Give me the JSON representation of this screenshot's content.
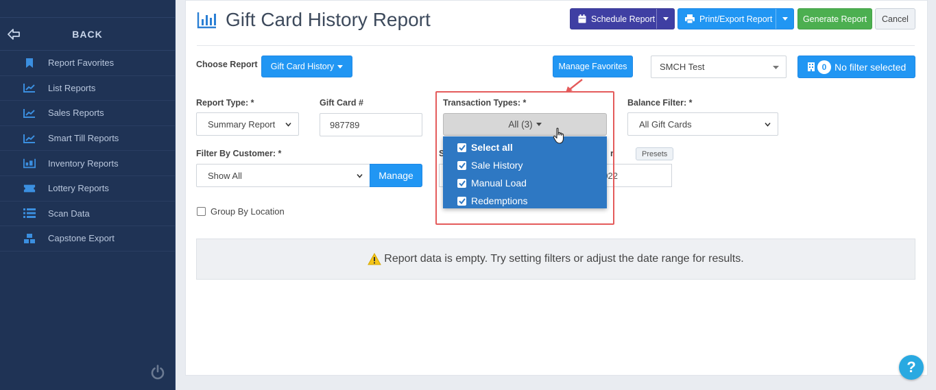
{
  "sidebar": {
    "back_label": "BACK",
    "items": [
      {
        "label": "Report Favorites",
        "icon": "bookmark-icon"
      },
      {
        "label": "List Reports",
        "icon": "line-chart-icon"
      },
      {
        "label": "Sales Reports",
        "icon": "line-chart-icon"
      },
      {
        "label": "Smart Till Reports",
        "icon": "line-chart-icon"
      },
      {
        "label": "Inventory Reports",
        "icon": "inventory-icon"
      },
      {
        "label": "Lottery Reports",
        "icon": "ticket-icon"
      },
      {
        "label": "Scan Data",
        "icon": "list-icon"
      },
      {
        "label": "Capstone Export",
        "icon": "boxes-icon"
      }
    ]
  },
  "header": {
    "title": "Gift Card History Report",
    "schedule_label": "Schedule Report",
    "print_label": "Print/Export Report",
    "generate_label": "Generate Report",
    "cancel_label": "Cancel"
  },
  "toolbar": {
    "choose_report_label": "Choose Report",
    "report_button_label": "Gift Card History",
    "manage_favorites_label": "Manage Favorites",
    "store_value": "SMCH Test",
    "filter_count": "0",
    "filter_label": "No filter selected"
  },
  "filters": {
    "report_type_label": "Report Type: *",
    "report_type_value": "Summary Report",
    "gift_card_label": "Gift Card #",
    "gift_card_value": "987789",
    "transaction_types_label": "Transaction Types: *",
    "transaction_types_value": "All (3)",
    "transaction_options": [
      {
        "label": "Select all",
        "checked": true
      },
      {
        "label": "Sale History",
        "checked": true
      },
      {
        "label": "Manual Load",
        "checked": true
      },
      {
        "label": "Redemptions",
        "checked": true
      }
    ],
    "balance_filter_label": "Balance Filter: *",
    "balance_filter_value": "All Gift Cards",
    "customer_label": "Filter By Customer: *",
    "customer_value": "Show All",
    "manage_label": "Manage",
    "presets_label": "Presets",
    "date_partial": "022",
    "date_label_partial": "S",
    "date_label_end": "r",
    "group_by_location_label": "Group By Location"
  },
  "empty_message": "Report data is empty. Try setting filters or adjust the date range for results.",
  "colors": {
    "sidebar": "#1f3355",
    "primary": "#2196f3",
    "schedule": "#3f3fa3",
    "generate": "#4caf50",
    "highlight": "#e45a5a",
    "dropdown": "#2e78c3"
  }
}
